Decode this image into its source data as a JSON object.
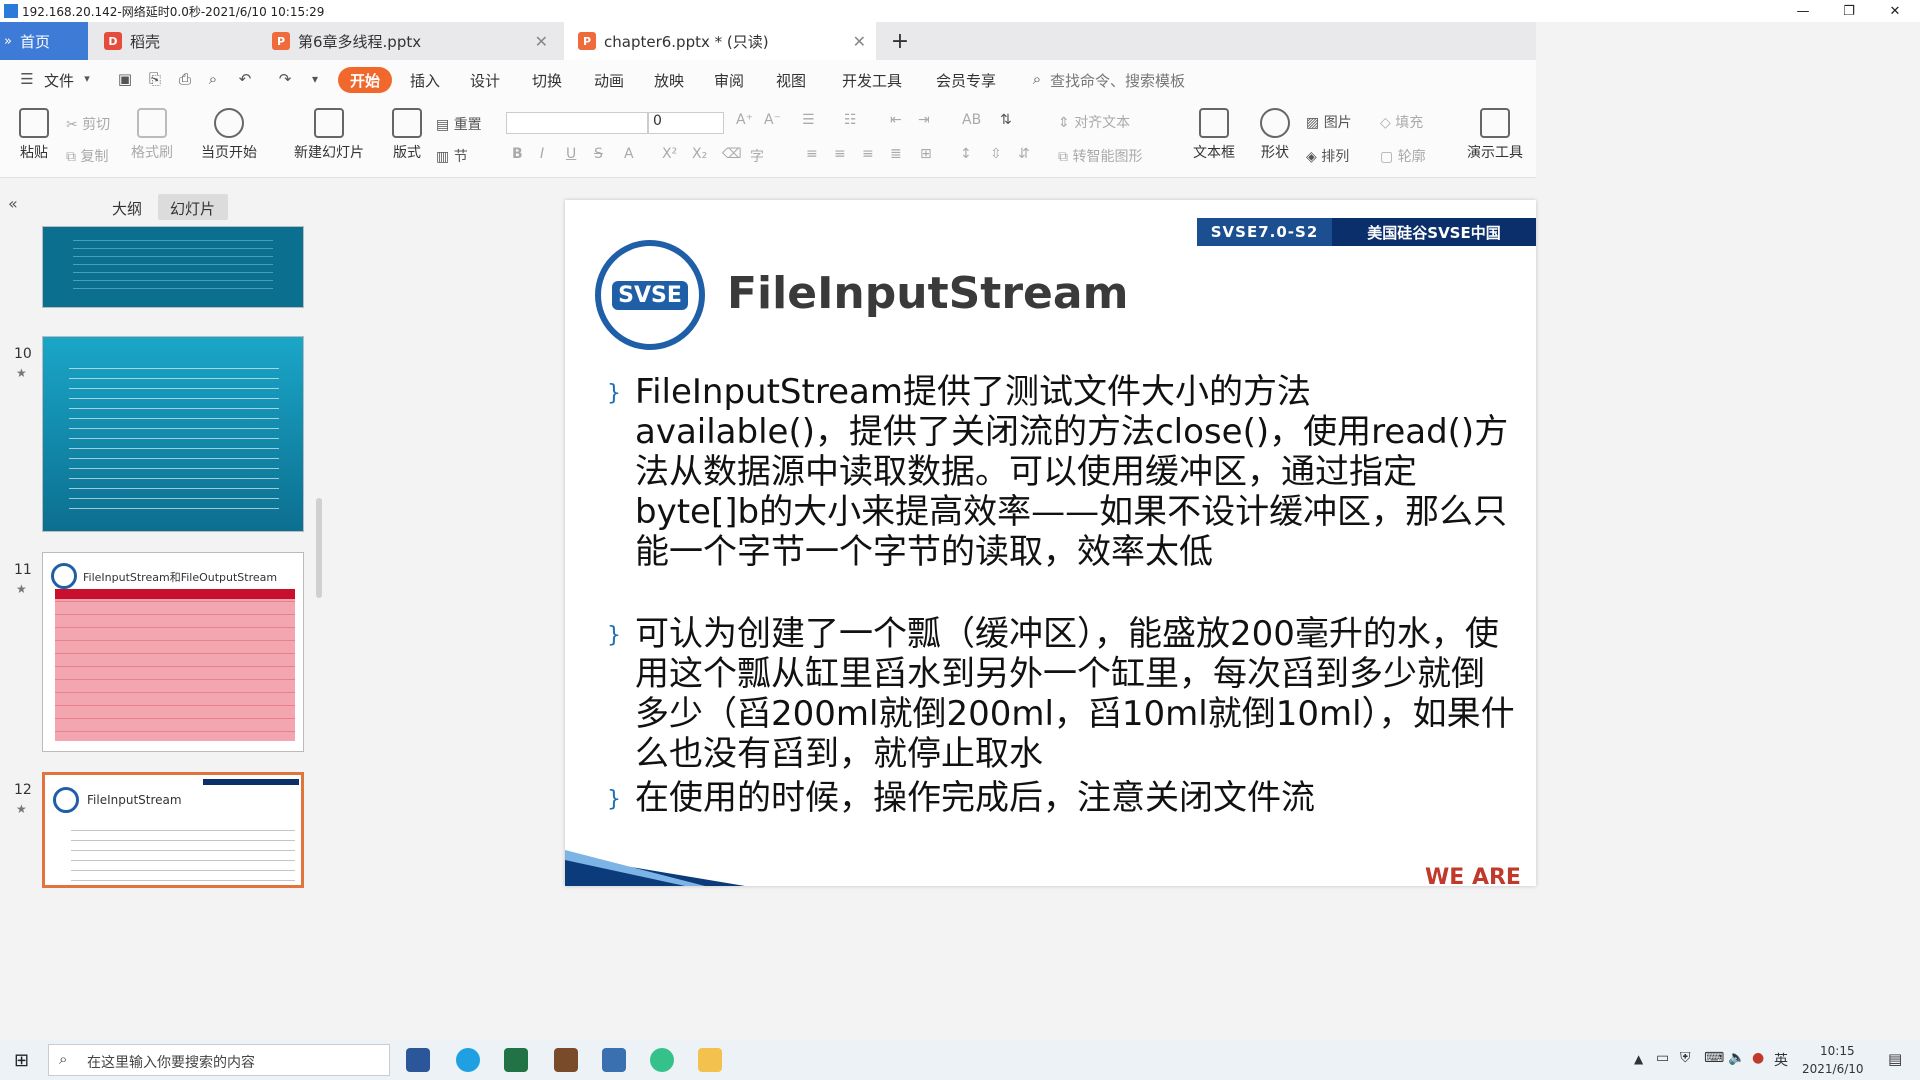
{
  "window": {
    "title": "192.168.20.142-网络延时0.0秒-2021/6/10 10:15:29"
  },
  "tabs": [
    {
      "label": "首页"
    },
    {
      "label": "稻壳"
    },
    {
      "label": "第6章多线程.pptx"
    },
    {
      "label": "chapter6.pptx * (只读)"
    }
  ],
  "menu": {
    "file": "文件",
    "items": [
      "开始",
      "插入",
      "设计",
      "切换",
      "动画",
      "放映",
      "审阅",
      "视图",
      "开发工具",
      "会员专享"
    ],
    "search_placeholder": "查找命令、搜索模板"
  },
  "ribbon": {
    "paste": "粘贴",
    "cut": "剪切",
    "copy": "复制",
    "format_painter": "格式刷",
    "from_current": "当页开始",
    "new_slide": "新建幻灯片",
    "layout": "版式",
    "reset": "重置",
    "section": "节",
    "font_size": "0",
    "align_text": "对齐文本",
    "smartart": "转智能图形",
    "textbox": "文本框",
    "shape": "形状",
    "picture": "图片",
    "arrange": "排列",
    "fill": "填充",
    "outline": "轮廓",
    "present_tools": "演示工具"
  },
  "leftpane": {
    "tab_outline": "大纲",
    "tab_slides": "幻灯片",
    "slides": [
      {
        "num": "10"
      },
      {
        "num": "11",
        "title": "FileInputStream和FileOutputStream"
      },
      {
        "num": "12",
        "title": "FileInputStream"
      }
    ]
  },
  "slide": {
    "header_left": "SVSE7.0-S2",
    "header_right": "美国硅谷SVSE中国",
    "logo_text": "SVSE",
    "title": "FileInputStream",
    "bullets": [
      "FileInputStream提供了测试文件大小的方法available()，提供了关闭流的方法close()，使用read()方法从数据源中读取数据。可以使用缓冲区，通过指定byte[]b的大小来提高效率——如果不设计缓冲区，那么只能一个字节一个字节的读取，效率太低",
      "可认为创建了一个瓢（缓冲区），能盛放200毫升的水，使用这个瓢从缸里舀水到另外一个缸里，每次舀到多少就倒多少（舀200ml就倒200ml，舀10ml就倒10ml），如果什么也没有舀到，就停止取水",
      "在使用的时候，操作完成后，注意关闭文件流"
    ],
    "footer_text": "WE ARE"
  },
  "taskbar": {
    "search_placeholder": "在这里输入你要搜索的内容",
    "ime": "英",
    "time": "10:15",
    "date": "2021/6/10"
  }
}
